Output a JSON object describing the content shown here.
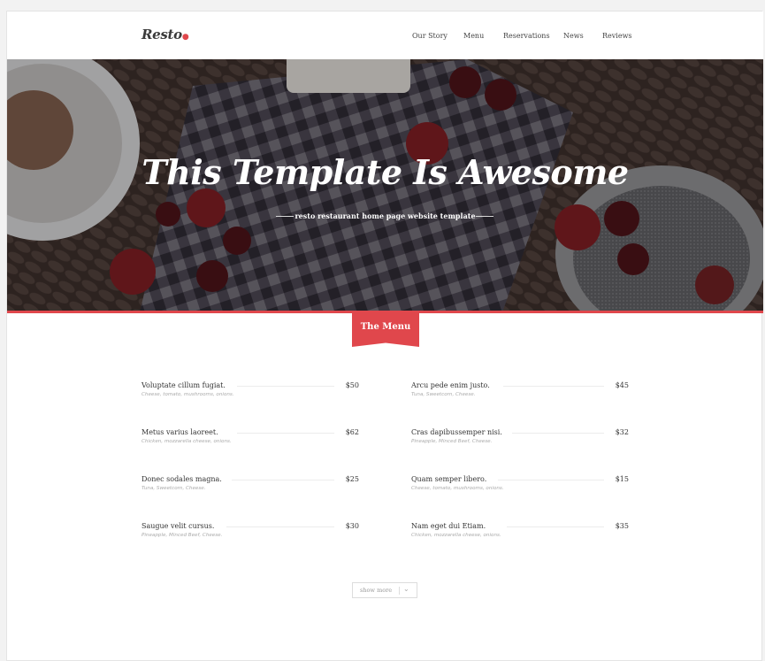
{
  "header": {
    "logo": "Resto",
    "logo_dot": "●",
    "nav": [
      "Our Story",
      "Menu",
      "Reservations",
      "News",
      "Reviews"
    ]
  },
  "hero": {
    "title": "This Template Is Awesome",
    "subtitle": "resto restaurant home page website template"
  },
  "menu_section": {
    "ribbon_label": "The Menu",
    "items": [
      {
        "name": "Voluptate cillum fugiat.",
        "desc": "Cheese, tomato, mushrooms, onions.",
        "price": "$50"
      },
      {
        "name": "Arcu pede enim justo.",
        "desc": "Tuna, Sweetcorn, Cheese.",
        "price": "$45"
      },
      {
        "name": "Metus varius laoreet.",
        "desc": "Chicken, mozzarella cheese, onions.",
        "price": "$62"
      },
      {
        "name": "Cras dapibussemper nisi.",
        "desc": "Pineapple, Minced Beef, Cheese.",
        "price": "$32"
      },
      {
        "name": "Donec sodales magna.",
        "desc": "Tuna, Sweetcorn, Cheese.",
        "price": "$25"
      },
      {
        "name": "Quam semper libero.",
        "desc": "Cheese, tomato, mushrooms, onions.",
        "price": "$15"
      },
      {
        "name": "Saugue velit cursus.",
        "desc": "Pineapple, Minced Beef, Cheese.",
        "price": "$30"
      },
      {
        "name": "Nam eget dui Etiam.",
        "desc": "Chicken, mozzarella cheese, onions.",
        "price": "$35"
      }
    ],
    "show_more": "show more",
    "chevron": "⌄"
  },
  "colors": {
    "accent": "#e0474c",
    "hero_overlay": "#2a2327"
  }
}
